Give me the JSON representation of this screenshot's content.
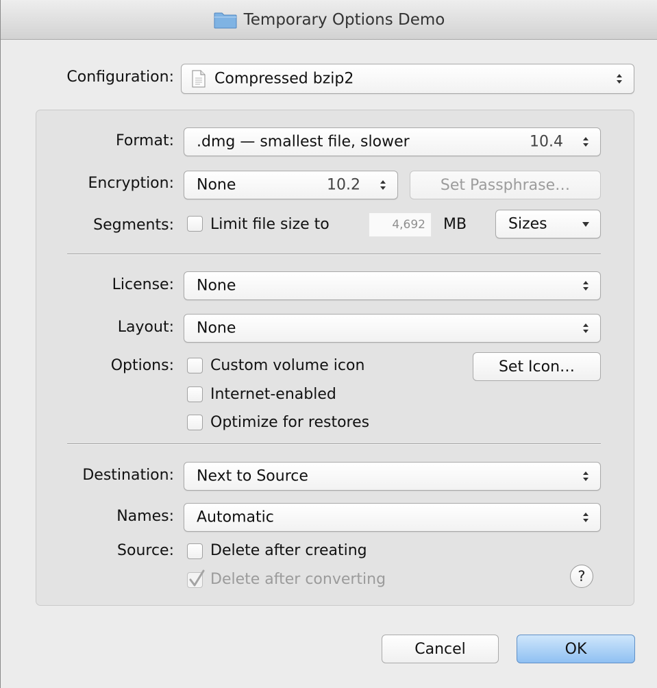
{
  "window": {
    "title": "Temporary Options Demo"
  },
  "configuration": {
    "label": "Configuration:",
    "value": "Compressed bzip2"
  },
  "format": {
    "label": "Format:",
    "value": ".dmg — smallest file, slower",
    "version": "10.4"
  },
  "encryption": {
    "label": "Encryption:",
    "value": "None",
    "version": "10.2",
    "set_passphrase_label": "Set Passphrase…"
  },
  "segments": {
    "label": "Segments:",
    "checkbox_label": "Limit file size to",
    "checked": false,
    "size_value": "4,692",
    "unit": "MB",
    "sizes_label": "Sizes"
  },
  "license": {
    "label": "License:",
    "value": "None"
  },
  "layout": {
    "label": "Layout:",
    "value": "None"
  },
  "options": {
    "label": "Options:",
    "items": [
      {
        "label": "Custom volume icon",
        "checked": false
      },
      {
        "label": "Internet-enabled",
        "checked": false
      },
      {
        "label": "Optimize for restores",
        "checked": false
      }
    ],
    "set_icon_label": "Set Icon…"
  },
  "destination": {
    "label": "Destination:",
    "value": "Next to Source"
  },
  "names": {
    "label": "Names:",
    "value": "Automatic"
  },
  "source": {
    "label": "Source:",
    "items": [
      {
        "label": "Delete after creating",
        "checked": false,
        "enabled": true
      },
      {
        "label": "Delete after converting",
        "checked": true,
        "enabled": false
      }
    ]
  },
  "help": {
    "label": "?"
  },
  "buttons": {
    "cancel_label": "Cancel",
    "ok_label": "OK"
  },
  "icons": {
    "title": "folder-icon",
    "configuration": "document-icon"
  },
  "colors": {
    "default_button": "#8fc0f2",
    "window_bg": "#ececec",
    "group_bg": "#e3e3e3"
  }
}
